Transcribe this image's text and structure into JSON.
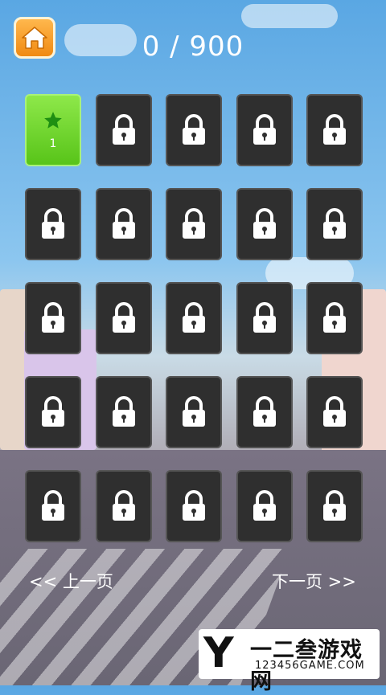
{
  "header": {
    "home_icon": "home-icon",
    "score": "0 / 900"
  },
  "levels": [
    {
      "label": "1",
      "locked": false,
      "star": true
    },
    {
      "label": "",
      "locked": true
    },
    {
      "label": "",
      "locked": true
    },
    {
      "label": "",
      "locked": true
    },
    {
      "label": "",
      "locked": true
    },
    {
      "label": "",
      "locked": true
    },
    {
      "label": "",
      "locked": true
    },
    {
      "label": "",
      "locked": true
    },
    {
      "label": "",
      "locked": true
    },
    {
      "label": "",
      "locked": true
    },
    {
      "label": "",
      "locked": true
    },
    {
      "label": "",
      "locked": true
    },
    {
      "label": "",
      "locked": true
    },
    {
      "label": "",
      "locked": true
    },
    {
      "label": "",
      "locked": true
    },
    {
      "label": "",
      "locked": true
    },
    {
      "label": "",
      "locked": true
    },
    {
      "label": "",
      "locked": true
    },
    {
      "label": "",
      "locked": true
    },
    {
      "label": "",
      "locked": true
    },
    {
      "label": "",
      "locked": true
    },
    {
      "label": "",
      "locked": true
    },
    {
      "label": "",
      "locked": true
    },
    {
      "label": "",
      "locked": true
    },
    {
      "label": "",
      "locked": true
    }
  ],
  "nav": {
    "prev": "<< 上一页",
    "next": "下一页 >>"
  },
  "watermark": {
    "title": "一二叁游戏网",
    "url": "123456GAME.COM"
  },
  "colors": {
    "locked_tile": "#2f2f2f",
    "open_tile": "#6fd22c",
    "home_button": "#f39a1f"
  }
}
